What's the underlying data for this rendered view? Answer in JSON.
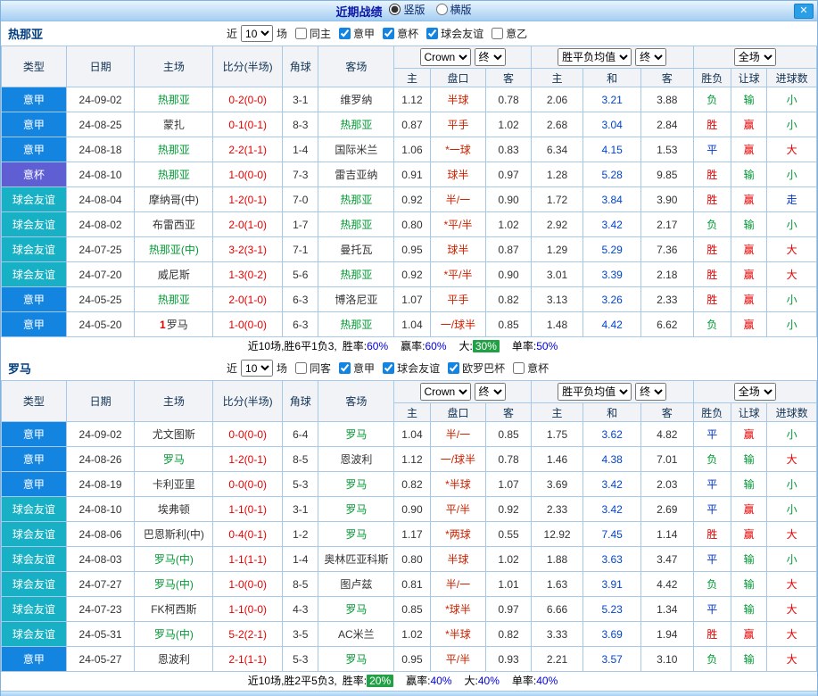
{
  "titlebar": {
    "title": "近期战绩",
    "layout_options": [
      {
        "label": "竖版",
        "selected": true
      },
      {
        "label": "横版",
        "selected": false
      }
    ],
    "close_label": "✕"
  },
  "filters_common": {
    "near_label": "近",
    "near_value": "10",
    "matches_label": "场"
  },
  "table_header": {
    "col_type": "类型",
    "col_date": "日期",
    "col_home": "主场",
    "col_score": "比分(半场)",
    "col_corner": "角球",
    "col_away": "客场",
    "odds_source_select": "Crown",
    "odds_time_select": "终",
    "avg_select": "胜平负均值",
    "avg_time_select": "终",
    "scope_select": "全场",
    "sub_home": "主",
    "sub_handicap": "盘口",
    "sub_away": "客",
    "sub_avg_home": "主",
    "sub_avg_draw": "和",
    "sub_avg_away": "客",
    "col_result": "胜负",
    "col_handicap_result": "让球",
    "col_goals": "进球数"
  },
  "league_colors": {
    "意甲": "#1385e0",
    "意杯": "#5f5fd3",
    "球会友谊": "#17b0c4"
  },
  "result_colors": {
    "胜": "#e60000",
    "平": "#0033cc",
    "负": "#009933",
    "赢": "#e60000",
    "走": "#0033cc",
    "输": "#009933",
    "大": "#e60000",
    "小": "#009933"
  },
  "badge_bg": "#22a045",
  "sections": [
    {
      "team": "热那亚",
      "filters": [
        {
          "label": "同主",
          "checked": false
        },
        {
          "label": "意甲",
          "checked": true
        },
        {
          "label": "意杯",
          "checked": true
        },
        {
          "label": "球会友谊",
          "checked": true
        },
        {
          "label": "意乙",
          "checked": false
        }
      ],
      "rows": [
        {
          "league": "意甲",
          "date": "24-09-02",
          "home": "热那亚",
          "home_subject": true,
          "home_mark": "",
          "score": "0-2",
          "half": "(0-0)",
          "corners": "3-1",
          "away": "维罗纳",
          "away_subject": false,
          "odds_home": "1.12",
          "handicap": "半球",
          "odds_away": "0.78",
          "avg_home": "2.06",
          "avg_draw": "3.21",
          "avg_away": "3.88",
          "result": "负",
          "handicap_result": "输",
          "goals": "小"
        },
        {
          "league": "意甲",
          "date": "24-08-25",
          "home": "蒙扎",
          "home_subject": false,
          "home_mark": "",
          "score": "0-1",
          "half": "(0-1)",
          "corners": "8-3",
          "away": "热那亚",
          "away_subject": true,
          "odds_home": "0.87",
          "handicap": "平手",
          "odds_away": "1.02",
          "avg_home": "2.68",
          "avg_draw": "3.04",
          "avg_away": "2.84",
          "result": "胜",
          "handicap_result": "赢",
          "goals": "小"
        },
        {
          "league": "意甲",
          "date": "24-08-18",
          "home": "热那亚",
          "home_subject": true,
          "home_mark": "",
          "score": "2-2",
          "half": "(1-1)",
          "corners": "1-4",
          "away": "国际米兰",
          "away_subject": false,
          "odds_home": "1.06",
          "handicap": "*一球",
          "odds_away": "0.83",
          "avg_home": "6.34",
          "avg_draw": "4.15",
          "avg_away": "1.53",
          "result": "平",
          "handicap_result": "赢",
          "goals": "大"
        },
        {
          "league": "意杯",
          "date": "24-08-10",
          "home": "热那亚",
          "home_subject": true,
          "home_mark": "",
          "score": "1-0",
          "half": "(0-0)",
          "corners": "7-3",
          "away": "雷吉亚纳",
          "away_subject": false,
          "odds_home": "0.91",
          "handicap": "球半",
          "odds_away": "0.97",
          "avg_home": "1.28",
          "avg_draw": "5.28",
          "avg_away": "9.85",
          "result": "胜",
          "handicap_result": "输",
          "goals": "小"
        },
        {
          "league": "球会友谊",
          "date": "24-08-04",
          "home": "摩纳哥(中)",
          "home_subject": false,
          "home_mark": "",
          "score": "1-2",
          "half": "(0-1)",
          "corners": "7-0",
          "away": "热那亚",
          "away_subject": true,
          "odds_home": "0.92",
          "handicap": "半/一",
          "odds_away": "0.90",
          "avg_home": "1.72",
          "avg_draw": "3.84",
          "avg_away": "3.90",
          "result": "胜",
          "handicap_result": "赢",
          "goals": "走"
        },
        {
          "league": "球会友谊",
          "date": "24-08-02",
          "home": "布雷西亚",
          "home_subject": false,
          "home_mark": "",
          "score": "2-0",
          "half": "(1-0)",
          "corners": "1-7",
          "away": "热那亚",
          "away_subject": true,
          "odds_home": "0.80",
          "handicap": "*平/半",
          "odds_away": "1.02",
          "avg_home": "2.92",
          "avg_draw": "3.42",
          "avg_away": "2.17",
          "result": "负",
          "handicap_result": "输",
          "goals": "小"
        },
        {
          "league": "球会友谊",
          "date": "24-07-25",
          "home": "热那亚(中)",
          "home_subject": true,
          "home_mark": "",
          "score": "3-2",
          "half": "(3-1)",
          "corners": "7-1",
          "away": "曼托瓦",
          "away_subject": false,
          "odds_home": "0.95",
          "handicap": "球半",
          "odds_away": "0.87",
          "avg_home": "1.29",
          "avg_draw": "5.29",
          "avg_away": "7.36",
          "result": "胜",
          "handicap_result": "赢",
          "goals": "大"
        },
        {
          "league": "球会友谊",
          "date": "24-07-20",
          "home": "威尼斯",
          "home_subject": false,
          "home_mark": "",
          "score": "1-3",
          "half": "(0-2)",
          "corners": "5-6",
          "away": "热那亚",
          "away_subject": true,
          "odds_home": "0.92",
          "handicap": "*平/半",
          "odds_away": "0.90",
          "avg_home": "3.01",
          "avg_draw": "3.39",
          "avg_away": "2.18",
          "result": "胜",
          "handicap_result": "赢",
          "goals": "大"
        },
        {
          "league": "意甲",
          "date": "24-05-25",
          "home": "热那亚",
          "home_subject": true,
          "home_mark": "",
          "score": "2-0",
          "half": "(1-0)",
          "corners": "6-3",
          "away": "博洛尼亚",
          "away_subject": false,
          "odds_home": "1.07",
          "handicap": "平手",
          "odds_away": "0.82",
          "avg_home": "3.13",
          "avg_draw": "3.26",
          "avg_away": "2.33",
          "result": "胜",
          "handicap_result": "赢",
          "goals": "小"
        },
        {
          "league": "意甲",
          "date": "24-05-20",
          "home": "罗马",
          "home_subject": false,
          "home_mark": "1",
          "score": "1-0",
          "half": "(0-0)",
          "corners": "6-3",
          "away": "热那亚",
          "away_subject": true,
          "odds_home": "1.04",
          "handicap": "一/球半",
          "odds_away": "0.85",
          "avg_home": "1.48",
          "avg_draw": "4.42",
          "avg_away": "6.62",
          "result": "负",
          "handicap_result": "赢",
          "goals": "小"
        }
      ],
      "summary": {
        "prefix": "近10场,胜6平1负3,",
        "items": [
          {
            "label": "胜率:",
            "value": "60%",
            "badge": false
          },
          {
            "label": "赢率:",
            "value": "60%",
            "badge": false
          },
          {
            "label": "大:",
            "value": "30%",
            "badge": true
          },
          {
            "label": "单率:",
            "value": "50%",
            "badge": false
          }
        ]
      }
    },
    {
      "team": "罗马",
      "filters": [
        {
          "label": "同客",
          "checked": false
        },
        {
          "label": "意甲",
          "checked": true
        },
        {
          "label": "球会友谊",
          "checked": true
        },
        {
          "label": "欧罗巴杯",
          "checked": true
        },
        {
          "label": "意杯",
          "checked": false
        }
      ],
      "rows": [
        {
          "league": "意甲",
          "date": "24-09-02",
          "home": "尤文图斯",
          "home_subject": false,
          "home_mark": "",
          "score": "0-0",
          "half": "(0-0)",
          "corners": "6-4",
          "away": "罗马",
          "away_subject": true,
          "odds_home": "1.04",
          "handicap": "半/一",
          "odds_away": "0.85",
          "avg_home": "1.75",
          "avg_draw": "3.62",
          "avg_away": "4.82",
          "result": "平",
          "handicap_result": "赢",
          "goals": "小"
        },
        {
          "league": "意甲",
          "date": "24-08-26",
          "home": "罗马",
          "home_subject": true,
          "home_mark": "",
          "score": "1-2",
          "half": "(0-1)",
          "corners": "8-5",
          "away": "恩波利",
          "away_subject": false,
          "odds_home": "1.12",
          "handicap": "一/球半",
          "odds_away": "0.78",
          "avg_home": "1.46",
          "avg_draw": "4.38",
          "avg_away": "7.01",
          "result": "负",
          "handicap_result": "输",
          "goals": "大"
        },
        {
          "league": "意甲",
          "date": "24-08-19",
          "home": "卡利亚里",
          "home_subject": false,
          "home_mark": "",
          "score": "0-0",
          "half": "(0-0)",
          "corners": "5-3",
          "away": "罗马",
          "away_subject": true,
          "odds_home": "0.82",
          "handicap": "*半球",
          "odds_away": "1.07",
          "avg_home": "3.69",
          "avg_draw": "3.42",
          "avg_away": "2.03",
          "result": "平",
          "handicap_result": "输",
          "goals": "小"
        },
        {
          "league": "球会友谊",
          "date": "24-08-10",
          "home": "埃弗顿",
          "home_subject": false,
          "home_mark": "",
          "score": "1-1",
          "half": "(0-1)",
          "corners": "3-1",
          "away": "罗马",
          "away_subject": true,
          "odds_home": "0.90",
          "handicap": "平/半",
          "odds_away": "0.92",
          "avg_home": "2.33",
          "avg_draw": "3.42",
          "avg_away": "2.69",
          "result": "平",
          "handicap_result": "赢",
          "goals": "小"
        },
        {
          "league": "球会友谊",
          "date": "24-08-06",
          "home": "巴恩斯利(中)",
          "home_subject": false,
          "home_mark": "",
          "score": "0-4",
          "half": "(0-1)",
          "corners": "1-2",
          "away": "罗马",
          "away_subject": true,
          "odds_home": "1.17",
          "handicap": "*两球",
          "odds_away": "0.55",
          "avg_home": "12.92",
          "avg_draw": "7.45",
          "avg_away": "1.14",
          "result": "胜",
          "handicap_result": "赢",
          "goals": "大"
        },
        {
          "league": "球会友谊",
          "date": "24-08-03",
          "home": "罗马(中)",
          "home_subject": true,
          "home_mark": "",
          "score": "1-1",
          "half": "(1-1)",
          "corners": "1-4",
          "away": "奥林匹亚科斯",
          "away_subject": false,
          "odds_home": "0.80",
          "handicap": "半球",
          "odds_away": "1.02",
          "avg_home": "1.88",
          "avg_draw": "3.63",
          "avg_away": "3.47",
          "result": "平",
          "handicap_result": "输",
          "goals": "小"
        },
        {
          "league": "球会友谊",
          "date": "24-07-27",
          "home": "罗马(中)",
          "home_subject": true,
          "home_mark": "",
          "score": "1-0",
          "half": "(0-0)",
          "corners": "8-5",
          "away": "图卢兹",
          "away_subject": false,
          "odds_home": "0.81",
          "handicap": "半/一",
          "odds_away": "1.01",
          "avg_home": "1.63",
          "avg_draw": "3.91",
          "avg_away": "4.42",
          "result": "负",
          "handicap_result": "输",
          "goals": "大"
        },
        {
          "league": "球会友谊",
          "date": "24-07-23",
          "home": "FK柯西斯",
          "home_subject": false,
          "home_mark": "",
          "score": "1-1",
          "half": "(0-0)",
          "corners": "4-3",
          "away": "罗马",
          "away_subject": true,
          "odds_home": "0.85",
          "handicap": "*球半",
          "odds_away": "0.97",
          "avg_home": "6.66",
          "avg_draw": "5.23",
          "avg_away": "1.34",
          "result": "平",
          "handicap_result": "输",
          "goals": "大"
        },
        {
          "league": "球会友谊",
          "date": "24-05-31",
          "home": "罗马(中)",
          "home_subject": true,
          "home_mark": "",
          "score": "5-2",
          "half": "(2-1)",
          "corners": "3-5",
          "away": "AC米兰",
          "away_subject": false,
          "odds_home": "1.02",
          "handicap": "*半球",
          "odds_away": "0.82",
          "avg_home": "3.33",
          "avg_draw": "3.69",
          "avg_away": "1.94",
          "result": "胜",
          "handicap_result": "赢",
          "goals": "大"
        },
        {
          "league": "意甲",
          "date": "24-05-27",
          "home": "恩波利",
          "home_subject": false,
          "home_mark": "",
          "score": "2-1",
          "half": "(1-1)",
          "corners": "5-3",
          "away": "罗马",
          "away_subject": true,
          "odds_home": "0.95",
          "handicap": "平/半",
          "odds_away": "0.93",
          "avg_home": "2.21",
          "avg_draw": "3.57",
          "avg_away": "3.10",
          "result": "负",
          "handicap_result": "输",
          "goals": "大"
        }
      ],
      "summary": {
        "prefix": "近10场,胜2平5负3,",
        "items": [
          {
            "label": "胜率:",
            "value": "20%",
            "badge": true
          },
          {
            "label": "赢率:",
            "value": "40%",
            "badge": false
          },
          {
            "label": "大:",
            "value": "40%",
            "badge": false
          },
          {
            "label": "单率:",
            "value": "40%",
            "badge": false
          }
        ]
      }
    }
  ]
}
